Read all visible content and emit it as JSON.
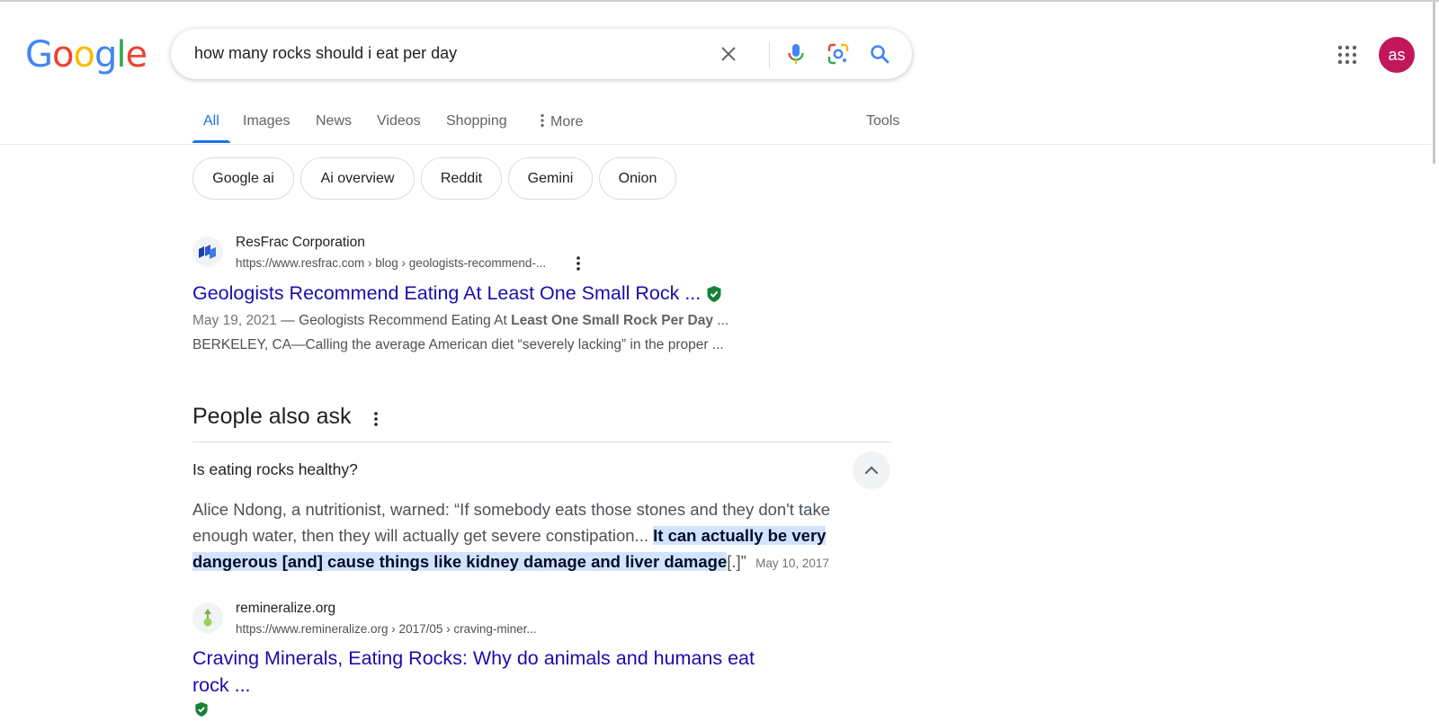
{
  "logo": {
    "letters": [
      "G",
      "o",
      "o",
      "g",
      "l",
      "e"
    ],
    "colors": [
      "#4285f4",
      "#ea4335",
      "#fbbc05",
      "#4285f4",
      "#34a853",
      "#ea4335"
    ]
  },
  "search": {
    "query": "how many rocks should i eat per day"
  },
  "account": {
    "initials": "as",
    "color": "#c2185b"
  },
  "tabs": [
    {
      "label": "All",
      "active": true
    },
    {
      "label": "Images"
    },
    {
      "label": "News"
    },
    {
      "label": "Videos"
    },
    {
      "label": "Shopping"
    },
    {
      "label": "More"
    }
  ],
  "tools_label": "Tools",
  "chips": [
    "Google ai",
    "Ai overview",
    "Reddit",
    "Gemini",
    "Onion"
  ],
  "results": [
    {
      "site_name": "ResFrac Corporation",
      "url": "https://www.resfrac.com › blog › geologists-recommend-...",
      "title": "Geologists Recommend Eating At Least One Small Rock ...",
      "verified": true,
      "snippet": {
        "date": "May 19, 2021",
        "separator": " — ",
        "line1_plain": "Geologists Recommend Eating At ",
        "line1_bold": "Least One Small Rock Per Day",
        "line1_end": " ...",
        "line2": "BERKELEY, CA—Calling the average American diet “severely lacking” in the proper ..."
      }
    },
    {
      "site_name": "remineralize.org",
      "url": "https://www.remineralize.org › 2017/05 › craving-miner...",
      "title_line1": "Craving Minerals, Eating Rocks: Why do animals and humans eat",
      "title_line2": "rock ...",
      "verified": true
    }
  ],
  "people_also_ask": {
    "heading": "People also ask",
    "question": "Is eating rocks healthy?",
    "answer": {
      "intro": "Alice Ndong, a nutritionist, warned: “If somebody eats those stones and they don't take enough water, then they will actually get severe constipation... ",
      "highlight": "It can actually be very dangerous [and] cause things like kidney damage and liver damage",
      "end": "[.]”",
      "date": "May 10, 2017"
    }
  },
  "colors": {
    "link": "#1a0dab",
    "accent": "#1a73e8",
    "highlight": "#d3e3fd"
  },
  "icons": [
    "clear-icon",
    "mic-icon",
    "lens-icon",
    "search-icon",
    "apps-grid-icon",
    "more-vert-icon",
    "chevron-up-icon",
    "verified-shield-icon"
  ]
}
